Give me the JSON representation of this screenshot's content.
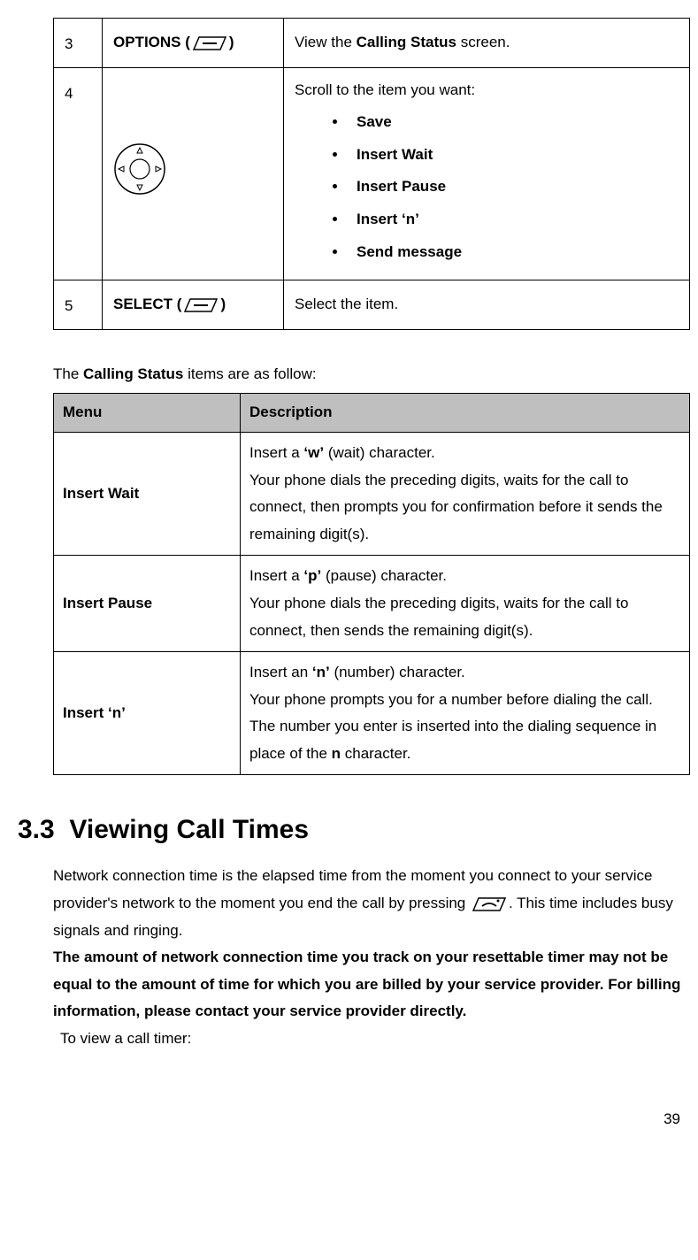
{
  "steps": {
    "row3": {
      "num": "3",
      "key_prefix": "OPTIONS (",
      "key_suffix": ")",
      "desc_pre": "View the ",
      "desc_bold": "Calling Status",
      "desc_post": " screen."
    },
    "row4": {
      "num": "4",
      "lead": "Scroll to the item you want:",
      "items": [
        "Save",
        "Insert Wait",
        "Insert Pause",
        "Insert ‘n’",
        "Send message"
      ]
    },
    "row5": {
      "num": "5",
      "key_prefix": "SELECT (",
      "key_suffix": ")",
      "desc": "Select the item."
    }
  },
  "intro_pre": "The ",
  "intro_bold": "Calling Status",
  "intro_post": " items are as follow:",
  "desc_table": {
    "h1": "Menu",
    "h2": "Description",
    "r1": {
      "menu": "Insert Wait",
      "l1a": "Insert a ",
      "l1b": "‘w’",
      "l1c": " (wait) character.",
      "l2": "Your phone dials the preceding digits, waits for the call to connect, then prompts you for confirmation before it sends the remaining digit(s)."
    },
    "r2": {
      "menu": "Insert Pause",
      "l1a": "Insert a ",
      "l1b": "‘p’",
      "l1c": " (pause) character.",
      "l2": "Your phone dials the preceding digits, waits for the call to connect, then sends the remaining digit(s)."
    },
    "r3": {
      "menu": "Insert ‘n’",
      "l1a": "Insert an ",
      "l1b": "‘n’",
      "l1c": " (number) character.",
      "l2a": "Your phone prompts you for a number before dialing the call. The number you enter is inserted into the dialing sequence in place of the ",
      "l2b": "n",
      "l2c": " character."
    }
  },
  "section": {
    "num": "3.3",
    "title": "Viewing Call Times",
    "p1a": "Network connection time is the elapsed time from the moment you connect to your service provider's network to the moment you end the call by pressing ",
    "p1b": ". This time includes busy signals and ringing.",
    "p2": "The amount of network connection time you track on your resettable timer may not be equal to the amount of time for which you are billed by your service provider. For billing information, please contact your service provider directly.",
    "p3": "To view a call timer:"
  },
  "page": "39"
}
